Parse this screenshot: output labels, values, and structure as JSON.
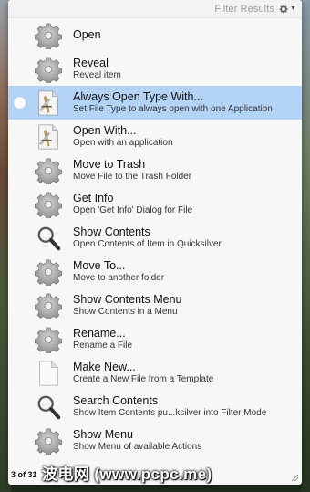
{
  "header": {
    "filter_label": "Filter Results",
    "menu_icon": "gear-icon"
  },
  "actions": [
    {
      "title": "Open",
      "subtitle": "",
      "icon": "gear-icon",
      "selected": false
    },
    {
      "title": "Reveal",
      "subtitle": "Reveal item",
      "icon": "gear-icon",
      "selected": false
    },
    {
      "title": "Always Open Type With...",
      "subtitle": "Set File Type to always open with one Application",
      "icon": "application-doc-icon",
      "selected": true
    },
    {
      "title": "Open With...",
      "subtitle": "Open with an application",
      "icon": "application-doc-icon",
      "selected": false
    },
    {
      "title": "Move to Trash",
      "subtitle": "Move File to the Trash Folder",
      "icon": "gear-icon",
      "selected": false
    },
    {
      "title": "Get Info",
      "subtitle": "Open 'Get Info' Dialog for File",
      "icon": "gear-icon",
      "selected": false
    },
    {
      "title": "Show Contents",
      "subtitle": "Open Contents of Item in Quicksilver",
      "icon": "magnifier-icon",
      "selected": false
    },
    {
      "title": "Move To...",
      "subtitle": "Move to another folder",
      "icon": "gear-icon",
      "selected": false
    },
    {
      "title": "Show Contents Menu",
      "subtitle": "Show Contents in a Menu",
      "icon": "gear-icon",
      "selected": false
    },
    {
      "title": "Rename...",
      "subtitle": "Rename a File",
      "icon": "gear-icon",
      "selected": false
    },
    {
      "title": "Make New...",
      "subtitle": "Create a New File from a Template",
      "icon": "blank-document-icon",
      "selected": false
    },
    {
      "title": "Search Contents",
      "subtitle": "Show Item Contents pu...ksilver into Filter Mode",
      "icon": "magnifier-icon",
      "selected": false
    },
    {
      "title": "Show Menu",
      "subtitle": "Show Menu of available Actions",
      "icon": "gear-icon",
      "selected": false
    }
  ],
  "footer": {
    "count": "3 of 31",
    "watermark": "波电网 (www.pcpc.me)"
  },
  "colors": {
    "selection": "#b3d4f7",
    "panel": "#f7f7f7"
  }
}
